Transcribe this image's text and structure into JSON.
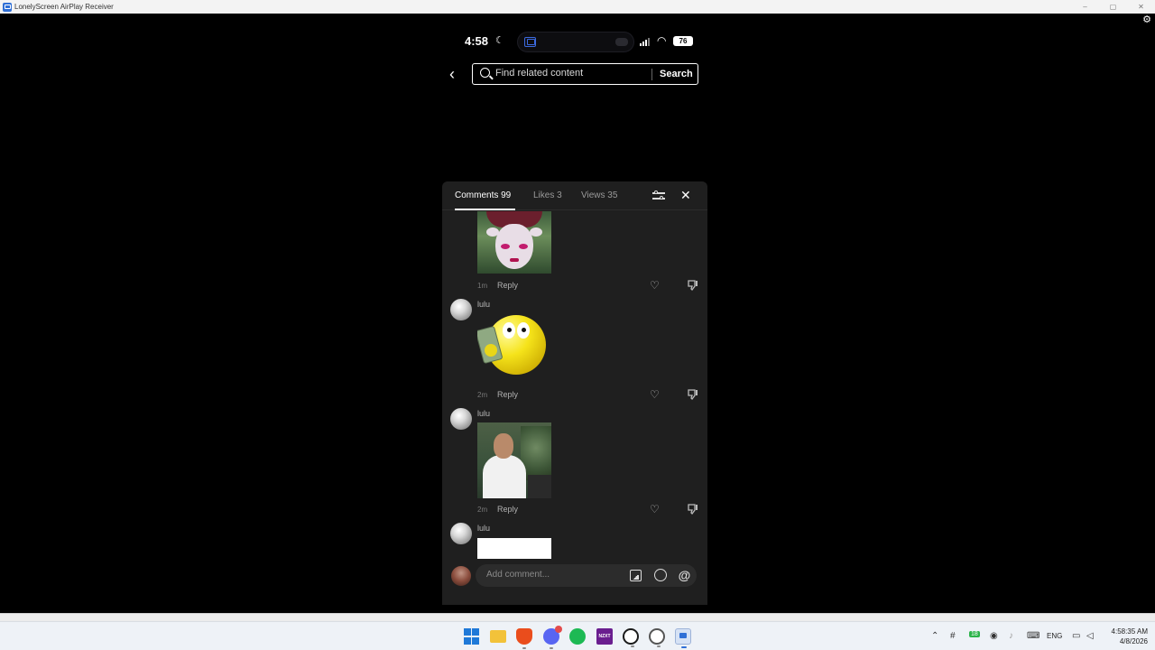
{
  "window": {
    "title": "LonelyScreen AirPlay Receiver",
    "controls": [
      "–",
      "▢",
      "✕"
    ]
  },
  "phone": {
    "status": {
      "time": "4:58",
      "battery": "76"
    },
    "search": {
      "placeholder": "Find related content",
      "button": "Search"
    },
    "panel": {
      "tabs": [
        {
          "label": "Comments 99",
          "active": true
        },
        {
          "label": "Likes 3",
          "active": false
        },
        {
          "label": "Views 35",
          "active": false
        }
      ],
      "comments": [
        {
          "username": "",
          "time": "1m",
          "reply": "Reply"
        },
        {
          "username": "lulu",
          "time": "2m",
          "reply": "Reply"
        },
        {
          "username": "lulu",
          "time": "2m",
          "reply": "Reply"
        },
        {
          "username": "lulu",
          "time": "",
          "reply": ""
        }
      ],
      "input": {
        "placeholder": "Add comment..."
      }
    }
  },
  "taskbar": {
    "apps": [
      "start-icon",
      "file-explorer-icon",
      "brave-icon",
      "discord-icon",
      "spotify-icon",
      "nzxt-icon",
      "steam-icon",
      "obs-icon",
      "lonelyscreen-icon"
    ],
    "next_label": "NZXT",
    "tray": {
      "slack_badge": "18",
      "language": "ENG"
    },
    "clock": {
      "time": "4:58:35 AM",
      "date": "4/8/2026"
    }
  }
}
